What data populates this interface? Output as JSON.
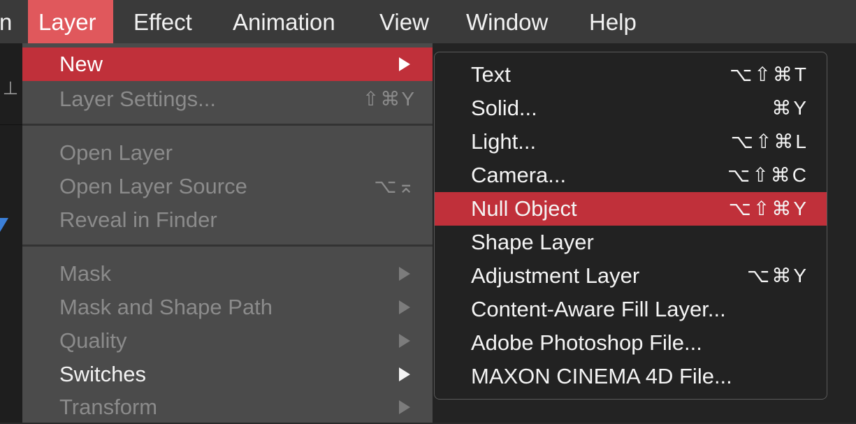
{
  "menubar": {
    "items": [
      {
        "label": "n",
        "active": false
      },
      {
        "label": "Layer",
        "active": true
      },
      {
        "label": "Effect",
        "active": false
      },
      {
        "label": "Animation",
        "active": false
      },
      {
        "label": "View",
        "active": false
      },
      {
        "label": "Window",
        "active": false
      },
      {
        "label": "Help",
        "active": false
      }
    ]
  },
  "layer_menu": {
    "items": [
      {
        "label": "New",
        "shortcut": "",
        "submenu": true,
        "enabled": true,
        "highlighted": true
      },
      {
        "label": "Layer Settings...",
        "shortcut": "⇧⌘Y",
        "submenu": false,
        "enabled": false
      },
      {
        "label": "Open Layer",
        "shortcut": "",
        "submenu": false,
        "enabled": false
      },
      {
        "label": "Open Layer Source",
        "shortcut": "⌥⌅",
        "submenu": false,
        "enabled": false
      },
      {
        "label": "Reveal in Finder",
        "shortcut": "",
        "submenu": false,
        "enabled": false
      },
      {
        "label": "Mask",
        "shortcut": "",
        "submenu": true,
        "enabled": false
      },
      {
        "label": "Mask and Shape Path",
        "shortcut": "",
        "submenu": true,
        "enabled": false
      },
      {
        "label": "Quality",
        "shortcut": "",
        "submenu": true,
        "enabled": false
      },
      {
        "label": "Switches",
        "shortcut": "",
        "submenu": true,
        "enabled": true
      },
      {
        "label": "Transform",
        "shortcut": "",
        "submenu": true,
        "enabled": false
      }
    ]
  },
  "new_submenu": {
    "items": [
      {
        "label": "Text",
        "shortcut": "⌥⇧⌘T",
        "highlighted": false
      },
      {
        "label": "Solid...",
        "shortcut": "⌘Y",
        "highlighted": false
      },
      {
        "label": "Light...",
        "shortcut": "⌥⇧⌘L",
        "highlighted": false
      },
      {
        "label": "Camera...",
        "shortcut": "⌥⇧⌘C",
        "highlighted": false
      },
      {
        "label": "Null Object",
        "shortcut": "⌥⇧⌘Y",
        "highlighted": true
      },
      {
        "label": "Shape Layer",
        "shortcut": "",
        "highlighted": false
      },
      {
        "label": "Adjustment Layer",
        "shortcut": "⌥⌘Y",
        "highlighted": false
      },
      {
        "label": "Content-Aware Fill Layer...",
        "shortcut": "",
        "highlighted": false
      },
      {
        "label": "Adobe Photoshop File...",
        "shortcut": "",
        "highlighted": false
      },
      {
        "label": "MAXON CINEMA 4D File...",
        "shortcut": "",
        "highlighted": false
      }
    ]
  },
  "icons": {
    "tool_icon": "stamp-icon",
    "submenu_arrow": "submenu-arrow-icon"
  },
  "colors": {
    "menubar_active": "#e0585c",
    "menu_highlight": "#c0303a",
    "menu_bg": "#4b4b4b",
    "submenu_bg": "#222222"
  }
}
